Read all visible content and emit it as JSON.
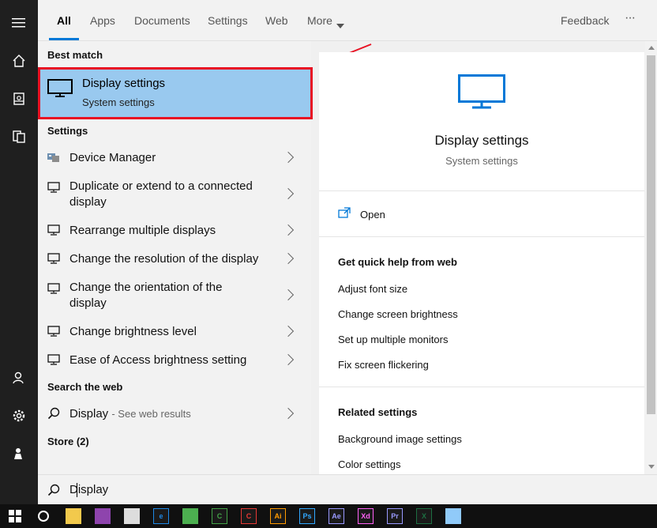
{
  "tabs": {
    "all": "All",
    "apps": "Apps",
    "documents": "Documents",
    "settings": "Settings",
    "web": "Web",
    "more": "More",
    "feedback": "Feedback",
    "ellipsis": "···"
  },
  "left": {
    "best_match_heading": "Best match",
    "best_title": "Display settings",
    "best_subtitle": "System settings",
    "settings_heading": "Settings",
    "items": [
      {
        "label": "Device Manager"
      },
      {
        "label": "Duplicate or extend to a connected display"
      },
      {
        "label": "Rearrange multiple displays"
      },
      {
        "label": "Change the resolution of the display"
      },
      {
        "label": "Change the orientation of the display"
      },
      {
        "label": "Change brightness level"
      },
      {
        "label": "Ease of Access brightness setting"
      }
    ],
    "search_web_heading": "Search the web",
    "web_query": "Display",
    "web_hint": "- See web results",
    "store_heading": "Store (2)"
  },
  "preview": {
    "title": "Display settings",
    "subtitle": "System settings",
    "open_label": "Open",
    "quick_help_heading": "Get quick help from web",
    "quick_help": [
      "Adjust font size",
      "Change screen brightness",
      "Set up multiple monitors",
      "Fix screen flickering"
    ],
    "related_heading": "Related settings",
    "related": [
      "Background image settings",
      "Color settings"
    ]
  },
  "search": {
    "value": "Display"
  },
  "taskbar": {
    "apps": [
      {
        "name": "file-explorer-icon",
        "text": "",
        "color": "#f2c94c"
      },
      {
        "name": "feather-app-icon",
        "text": "",
        "color": "#8e44ad"
      },
      {
        "name": "clapperboard-icon",
        "text": "",
        "color": "#dddddd"
      },
      {
        "name": "edge-icon",
        "text": "e",
        "color": "#1e88e5"
      },
      {
        "name": "chrome-icon",
        "text": "",
        "color": "#4caf50"
      },
      {
        "name": "camtasia-icon",
        "text": "C",
        "color": "#43a047"
      },
      {
        "name": "red-c-app-icon",
        "text": "C",
        "color": "#e53935"
      },
      {
        "name": "illustrator-icon",
        "text": "Ai",
        "color": "#ff9a00"
      },
      {
        "name": "photoshop-icon",
        "text": "Ps",
        "color": "#31a8ff"
      },
      {
        "name": "after-effects-icon",
        "text": "Ae",
        "color": "#9999ff"
      },
      {
        "name": "xd-icon",
        "text": "Xd",
        "color": "#ff61f6"
      },
      {
        "name": "premiere-icon",
        "text": "Pr",
        "color": "#9999ff"
      },
      {
        "name": "excel-icon",
        "text": "X",
        "color": "#1d6f42"
      },
      {
        "name": "notepad-icon",
        "text": "",
        "color": "#90caf9"
      }
    ]
  },
  "colors": {
    "accent": "#0078d7",
    "highlight": "#99c9ef",
    "annotation_red": "#e81123"
  }
}
